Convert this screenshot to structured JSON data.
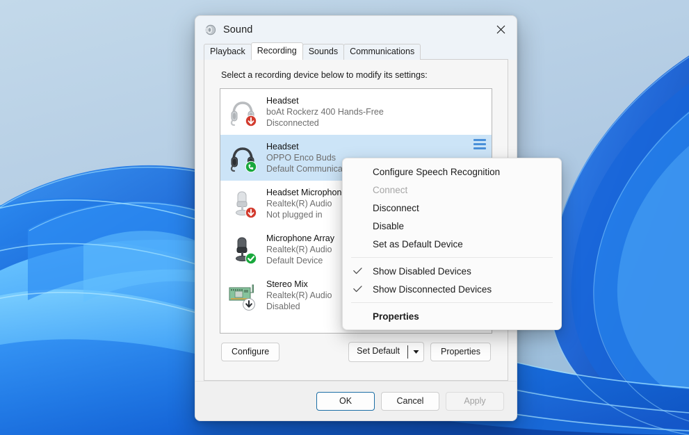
{
  "window": {
    "title": "Sound",
    "icon": "sound-speaker-icon",
    "close_label": "×",
    "tabs": [
      {
        "label": "Playback",
        "selected": false
      },
      {
        "label": "Recording",
        "selected": true
      },
      {
        "label": "Sounds",
        "selected": false
      },
      {
        "label": "Communications",
        "selected": false
      }
    ],
    "hint": "Select a recording device below to modify its settings:"
  },
  "devices": [
    {
      "name": "Headset",
      "description": "boAt Rockerz 400 Hands-Free",
      "status": "Disconnected",
      "icon": "headset-icon",
      "badge": "red-down-arrow-badge",
      "selected": false,
      "meter": false
    },
    {
      "name": "Headset",
      "description": "OPPO Enco Buds",
      "status": "Default Communications Device",
      "icon": "headset-icon",
      "badge": "green-phone-badge",
      "selected": true,
      "meter": true
    },
    {
      "name": "Headset Microphone",
      "description": "Realtek(R) Audio",
      "status": "Not plugged in",
      "icon": "microphone-icon",
      "badge": "red-down-arrow-badge",
      "selected": false,
      "meter": false
    },
    {
      "name": "Microphone Array",
      "description": "Realtek(R) Audio",
      "status": "Default Device",
      "icon": "microphone-icon",
      "badge": "green-check-badge",
      "selected": false,
      "meter": false
    },
    {
      "name": "Stereo Mix",
      "description": "Realtek(R) Audio",
      "status": "Disabled",
      "icon": "sound-card-icon",
      "badge": "gray-down-arrow-badge",
      "selected": false,
      "meter": false
    }
  ],
  "actions": {
    "configure": "Configure",
    "set_default": "Set Default",
    "set_default_arrow": "▼",
    "properties": "Properties"
  },
  "footer": {
    "ok": "OK",
    "cancel": "Cancel",
    "apply": "Apply"
  },
  "context_menu": {
    "items": [
      {
        "label": "Configure Speech Recognition",
        "disabled": false,
        "checked": false,
        "bold": false
      },
      {
        "label": "Connect",
        "disabled": true,
        "checked": false,
        "bold": false
      },
      {
        "label": "Disconnect",
        "disabled": false,
        "checked": false,
        "bold": false
      },
      {
        "label": "Disable",
        "disabled": false,
        "checked": false,
        "bold": false
      },
      {
        "label": "Set as Default Device",
        "disabled": false,
        "checked": false,
        "bold": false
      },
      {
        "separator": true
      },
      {
        "label": "Show Disabled Devices",
        "disabled": false,
        "checked": true,
        "bold": false
      },
      {
        "label": "Show Disconnected Devices",
        "disabled": false,
        "checked": true,
        "bold": false
      },
      {
        "separator": true
      },
      {
        "label": "Properties",
        "disabled": false,
        "checked": false,
        "bold": true
      }
    ]
  },
  "colors": {
    "selection": "#cce4f7",
    "accent": "#1b6ea5",
    "status_green": "#19a83c",
    "status_red": "#d23b2e",
    "desktop_top": "#bcd4e8",
    "desktop_blue": "#1a7ef0"
  }
}
